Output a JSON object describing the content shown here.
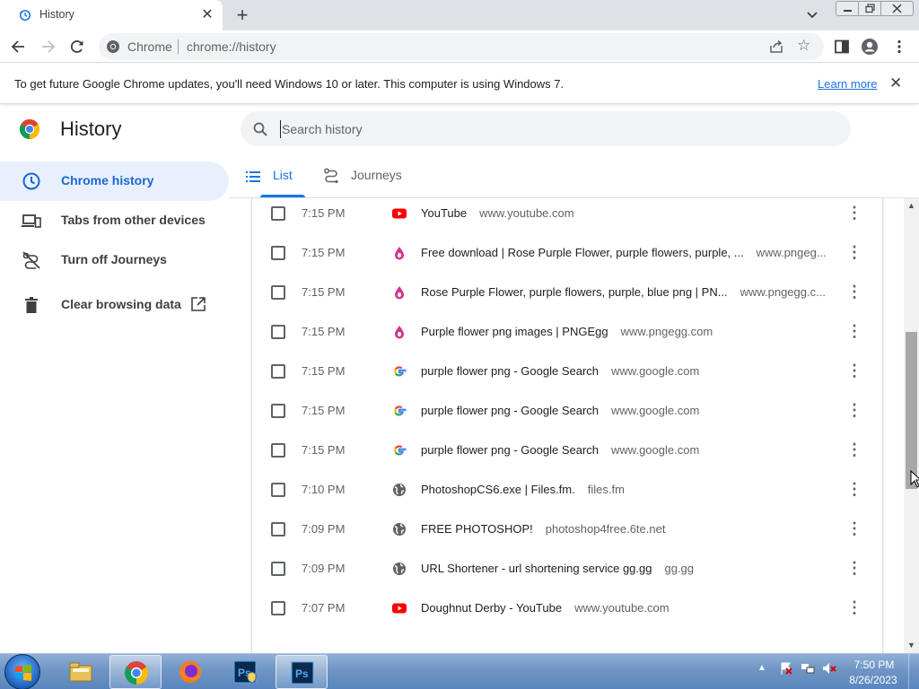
{
  "window": {
    "tab_title": "History",
    "new_tab_symbol": "+",
    "close_symbol": "✕"
  },
  "toolbar": {
    "site_label": "Chrome",
    "url": "chrome://history"
  },
  "infobar": {
    "message": "To get future Google Chrome updates, you'll need Windows 10 or later. This computer is using Windows 7.",
    "learn_more": "Learn more",
    "close_symbol": "✕"
  },
  "sidebar": {
    "title": "History",
    "items": [
      {
        "label": "Chrome history",
        "icon": "clock-icon",
        "active": true
      },
      {
        "label": "Tabs from other devices",
        "icon": "devices-icon",
        "active": false
      },
      {
        "label": "Turn off Journeys",
        "icon": "journeys-off-icon",
        "active": false
      },
      {
        "label": "Clear browsing data",
        "icon": "trash-icon",
        "active": false
      }
    ]
  },
  "search": {
    "placeholder": "Search history"
  },
  "tabs": [
    {
      "label": "List",
      "icon": "list-icon",
      "selected": true
    },
    {
      "label": "Journeys",
      "icon": "journeys-icon",
      "selected": false
    }
  ],
  "history": {
    "rows": [
      {
        "time": "7:15 PM",
        "favicon": "youtube",
        "title": "YouTube",
        "domain": "www.youtube.com"
      },
      {
        "time": "7:15 PM",
        "favicon": "pngegg",
        "title": "Free download | Rose Purple Flower, purple flowers, purple, ...",
        "domain": "www.pngeg..."
      },
      {
        "time": "7:15 PM",
        "favicon": "pngegg",
        "title": "Rose Purple Flower, purple flowers, purple, blue png | PN...",
        "domain": "www.pngegg.c..."
      },
      {
        "time": "7:15 PM",
        "favicon": "pngegg",
        "title": "Purple flower png images | PNGEgg",
        "domain": "www.pngegg.com"
      },
      {
        "time": "7:15 PM",
        "favicon": "google",
        "title": "purple flower png - Google Search",
        "domain": "www.google.com"
      },
      {
        "time": "7:15 PM",
        "favicon": "google",
        "title": "purple flower png - Google Search",
        "domain": "www.google.com"
      },
      {
        "time": "7:15 PM",
        "favicon": "google",
        "title": "purple flower png - Google Search",
        "domain": "www.google.com"
      },
      {
        "time": "7:10 PM",
        "favicon": "globe",
        "title": "PhotoshopCS6.exe | Files.fm.",
        "domain": "files.fm"
      },
      {
        "time": "7:09 PM",
        "favicon": "globe",
        "title": "FREE PHOTOSHOP!",
        "domain": "photoshop4free.6te.net"
      },
      {
        "time": "7:09 PM",
        "favicon": "globe",
        "title": "URL Shortener - url shortening service gg.gg",
        "domain": "gg.gg"
      },
      {
        "time": "7:07 PM",
        "favicon": "youtube",
        "title": "Doughnut Derby - YouTube",
        "domain": "www.youtube.com"
      }
    ]
  },
  "taskbar": {
    "apps": [
      "explorer-icon",
      "chrome-icon",
      "firefox-icon",
      "photoshop-icon",
      "photoshop-icon"
    ],
    "clock_time": "7:50 PM",
    "clock_date": "8/26/2023"
  },
  "colors": {
    "accent": "#1a73e8",
    "active_nav_bg": "#e8f0fe",
    "youtube": "#ff0000",
    "pngegg": "#d6338a"
  }
}
